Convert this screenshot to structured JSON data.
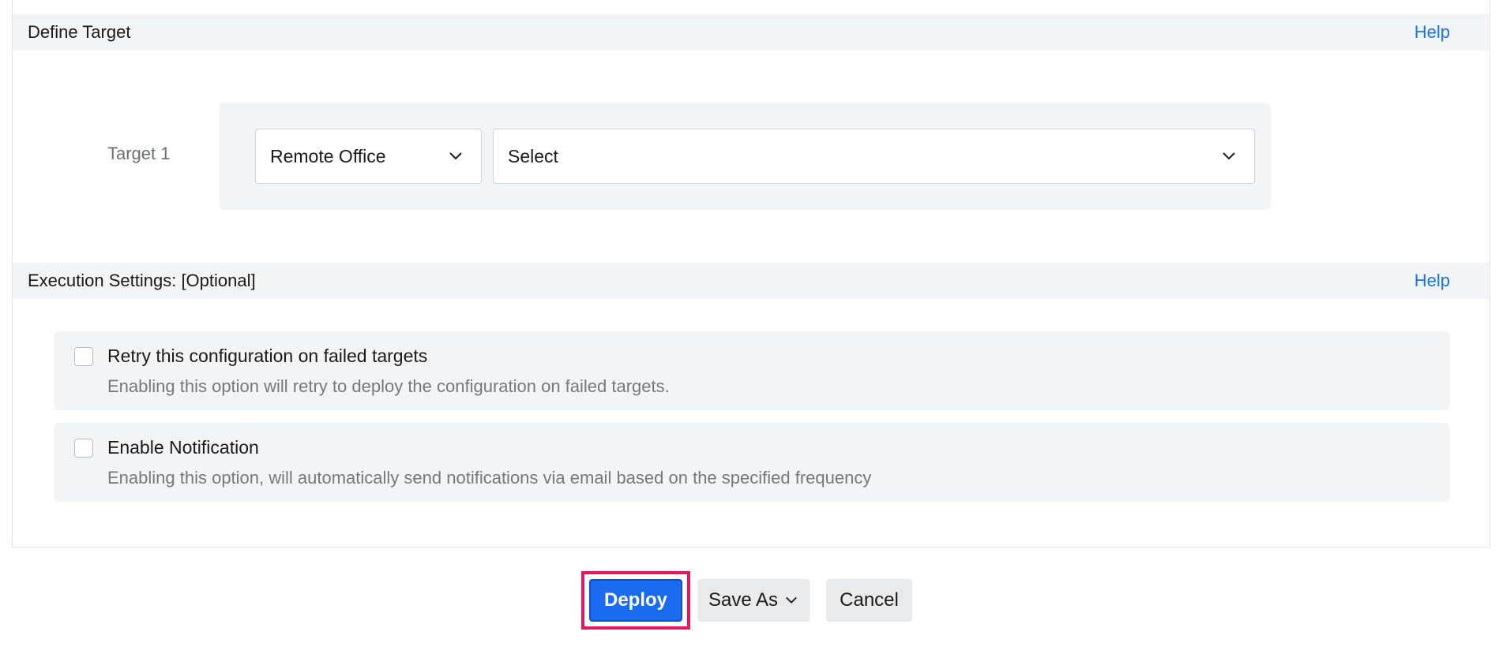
{
  "define_target": {
    "title": "Define Target",
    "help": "Help",
    "target_label": "Target 1",
    "type_select": "Remote Office",
    "value_select": "Select"
  },
  "execution": {
    "title": "Execution Settings: [Optional]",
    "help": "Help",
    "options": [
      {
        "title": "Retry this configuration on failed targets",
        "description": "Enabling this option will retry to deploy the configuration on failed targets.",
        "checked": false
      },
      {
        "title": "Enable Notification",
        "description": "Enabling this option, will automatically send notifications via email based on the specified frequency",
        "checked": false
      }
    ]
  },
  "actions": {
    "deploy": "Deploy",
    "save_as": "Save As",
    "cancel": "Cancel"
  },
  "colors": {
    "accent": "#1a6bf0",
    "highlight": "#e0185f",
    "link": "#1a73e8"
  }
}
